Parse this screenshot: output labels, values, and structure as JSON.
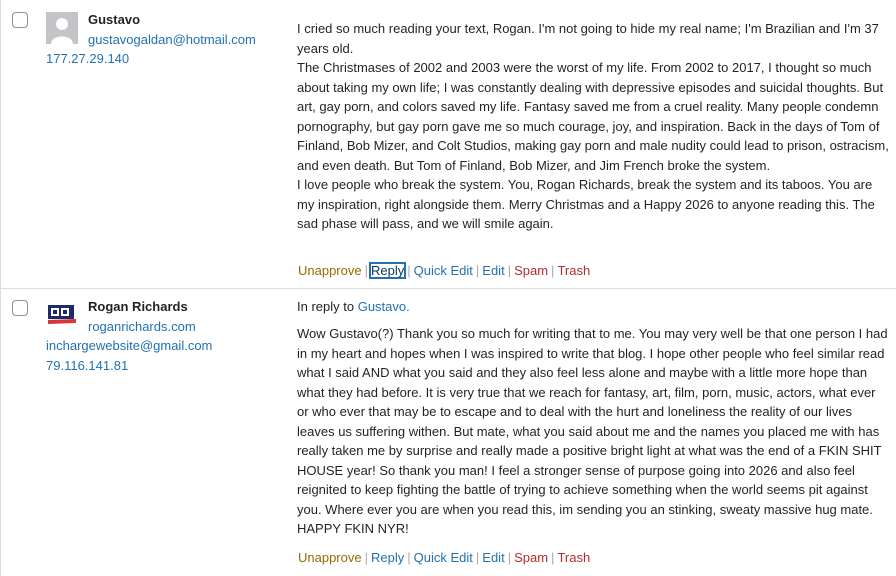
{
  "comments": [
    {
      "author": "Gustavo",
      "email": "gustavogaldan@hotmail.com",
      "ip": "177.27.29.140",
      "paragraphs": [
        "I cried so much reading your text, Rogan. I'm not going to hide my real name; I'm Brazilian and I'm 37 years old.",
        "The Christmases of 2002 and 2003 were the worst of my life. From 2002 to 2017, I thought so much about taking my own life; I was constantly dealing with depressive episodes and suicidal thoughts. But art, gay porn, and colors saved my life. Fantasy saved me from a cruel reality. Many people condemn pornography, but gay porn gave me so much courage, joy, and inspiration. Back in the days of Tom of Finland, Bob Mizer, and Colt Studios, making gay porn and male nudity could lead to prison, ostracism, and even death. But Tom of Finland, Bob Mizer, and Jim French broke the system.",
        "I love people who break the system. You, Rogan Richards, break the system and its taboos. You are my inspiration, right alongside them. Merry Christmas and a Happy 2026 to anyone reading this. The sad phase will pass, and we will smile again."
      ],
      "actions": {
        "unapprove": "Unapprove",
        "reply": "Reply",
        "quick_edit": "Quick Edit",
        "edit": "Edit",
        "spam": "Spam",
        "trash": "Trash"
      }
    },
    {
      "author": "Rogan Richards",
      "website": "roganrichards.com",
      "email": "inchargewebsite@gmail.com",
      "ip": "79.116.141.81",
      "in_reply_prefix": "In reply to",
      "in_reply_to": "Gustavo.",
      "paragraphs": [
        "Wow Gustavo(?) Thank you so much for writing that to me. You may very well be that one person I had in my heart and hopes when I was inspired to write that blog. I hope other people who feel similar read what I said AND what you said and they also feel less alone and maybe with a little more hope than what they had before. It is very true that we reach for fantasy, art, film, porn, music, actors, what ever or who ever that may be to escape and to deal with the hurt and loneliness the reality of our lives leaves us suffering withen. But mate, what you said about me and the names you placed me with has really taken me by surprise and really made a positive bright light at what was the end of a FKIN SHIT HOUSE year! So thank you man! I feel a stronger sense of purpose going into 2026 and also feel reignited to keep fighting the battle of trying to achieve something when the world seems pit against you. Where ever you are when you read this, im sending you an stinking, sweaty massive hug mate. HAPPY FKIN NYR!"
      ],
      "actions": {
        "unapprove": "Unapprove",
        "reply": "Reply",
        "quick_edit": "Quick Edit",
        "edit": "Edit",
        "spam": "Spam",
        "trash": "Trash"
      }
    }
  ],
  "colors": {
    "link": "#2271b1",
    "unapprove": "#996800",
    "danger": "#b32d2e",
    "border": "#dcdcde"
  },
  "icons": {
    "avatar_default": "default-avatar-icon",
    "avatar_custom": "rr-logo-avatar"
  }
}
